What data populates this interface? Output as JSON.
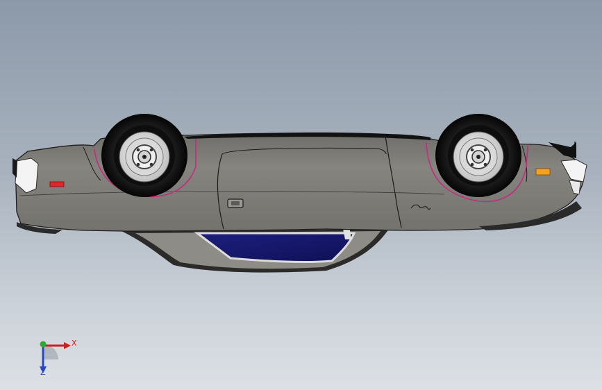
{
  "viewport": {
    "background_top": "#8c99a9",
    "background_bottom": "#dde1e6"
  },
  "model": {
    "body_color": "#7f7d78",
    "window_color": "#161766",
    "script_badge": "Challenger"
  },
  "triad": {
    "x_label": "X",
    "z_label": "Z",
    "x_color": "#d0201e",
    "y_color": "#2fa82f",
    "z_color": "#2a45c8"
  }
}
